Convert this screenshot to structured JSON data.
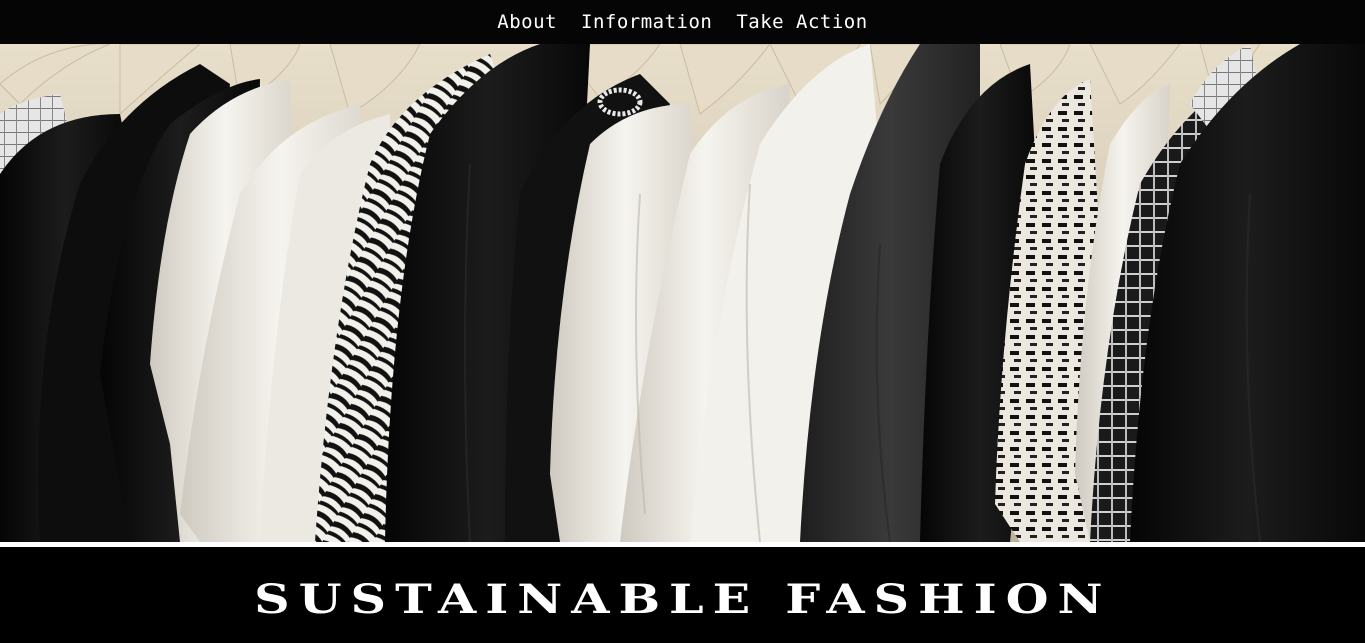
{
  "nav": {
    "items": [
      {
        "label": "About"
      },
      {
        "label": "Information"
      },
      {
        "label": "Take Action"
      }
    ]
  },
  "hero": {
    "image_description": "clothes-on-hangers-photo"
  },
  "page_title": "SUSTAINABLE FASHION",
  "colors": {
    "nav_bg": "#050505",
    "page_bg": "#000000",
    "text": "#ffffff",
    "hanger": "#e6dcc8"
  }
}
